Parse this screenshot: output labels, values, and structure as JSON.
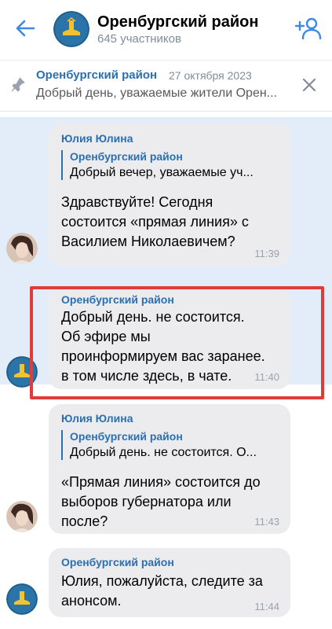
{
  "header": {
    "back_icon": "arrow-left-icon",
    "title": "Оренбургский район",
    "subtitle": "645 участников",
    "add_member_icon": "add-user-icon",
    "accent": "#3b8ae8"
  },
  "pinned": {
    "icon": "pin-icon",
    "author": "Оренбургский район",
    "date": "27 октября 2023",
    "text": "Добрый день, уважаемые жители Орен...",
    "close_icon": "close-icon"
  },
  "messages": [
    {
      "author": "Юлия Юлина",
      "reply_author": "Оренбургский район",
      "reply_text": "Добрый вечер, уважаемые уч...",
      "text": "Здравствуйте! Сегодня\nсостоится «прямая линия» с\nВасилием Николаевичем?",
      "time": "11:39",
      "avatar": "user-photo-avatar"
    },
    {
      "author": "Оренбургский район",
      "text": "Добрый день. не состоится.\nОб эфире мы\nпроинформируем вас заранее.\nв том числе здесь, в чате.",
      "time": "11:40",
      "avatar": "district-logo-avatar"
    },
    {
      "author": "Юлия Юлина",
      "reply_author": "Оренбургский район",
      "reply_text": "Добрый день. не состоится. О...",
      "text": "«Прямая линия» состоится до\nвыборов губернатора или\nпосле?",
      "time": "11:43",
      "avatar": "user-photo-avatar"
    },
    {
      "author": "Оренбургский район",
      "text": "Юлия, пожалуйста, следите за\nанонсом.",
      "time": "11:44",
      "avatar": "district-logo-avatar"
    }
  ],
  "logo_text": "Оренбургский район",
  "colors": {
    "link_blue": "#2a6fb1",
    "bubble": "#ececef",
    "highlight": "#e3edf9",
    "annotation_red": "#e23c3a"
  }
}
